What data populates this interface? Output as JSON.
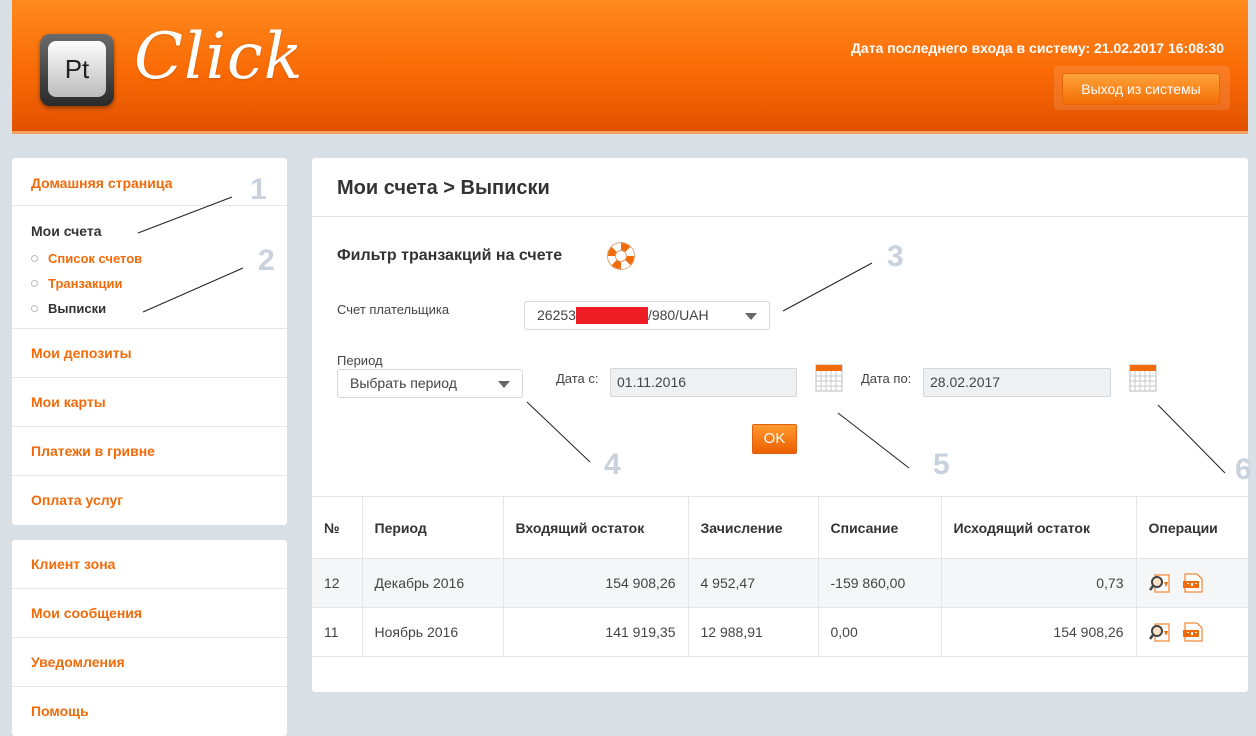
{
  "header": {
    "logo_badge": "Pt",
    "logo_text": "Click",
    "last_login": "Дата последнего входа в систему: 21.02.2017 16:08:30",
    "logout_label": "Выход из системы"
  },
  "sidebar": {
    "home": "Домашняя страница",
    "accounts": {
      "label": "Мои счета",
      "subitems": [
        "Список счетов",
        "Транзакции",
        "Выписки"
      ]
    },
    "items": [
      "Мои депозиты",
      "Мои карты",
      "Платежи в гривне",
      "Оплата услуг"
    ],
    "items2": [
      "Клиент зона",
      "Мои сообщения",
      "Уведомления",
      "Помощь"
    ]
  },
  "main": {
    "title": "Мои счета > Выписки",
    "filter_title": "Фильтр транзакций на счете",
    "payer_label": "Счет плательщика",
    "account_prefix": "26253",
    "account_suffix": "/980/UAH",
    "period_label": "Период",
    "period_value": "Выбрать период",
    "date_from_label": "Дата с:",
    "date_from": "01.11.2016",
    "date_to_label": "Дата по:",
    "date_to": "28.02.2017",
    "ok_label": "OK"
  },
  "table": {
    "headers": [
      "№",
      "Период",
      "Входящий остаток",
      "Зачисление",
      "Списание",
      "Исходящий остаток",
      "Операции"
    ],
    "rows": [
      [
        "12",
        "Декабрь 2016",
        "154 908,26",
        "4 952,47",
        "-159 860,00",
        "0,73"
      ],
      [
        "11",
        "Ноябрь 2016",
        "141 919,35",
        "12 988,91",
        "0,00",
        "154 908,26"
      ]
    ]
  },
  "annotations": [
    "1",
    "2",
    "3",
    "4",
    "5",
    "6"
  ],
  "colors": {
    "accent": "#f26b0a",
    "redaction": "#ee1c25"
  }
}
